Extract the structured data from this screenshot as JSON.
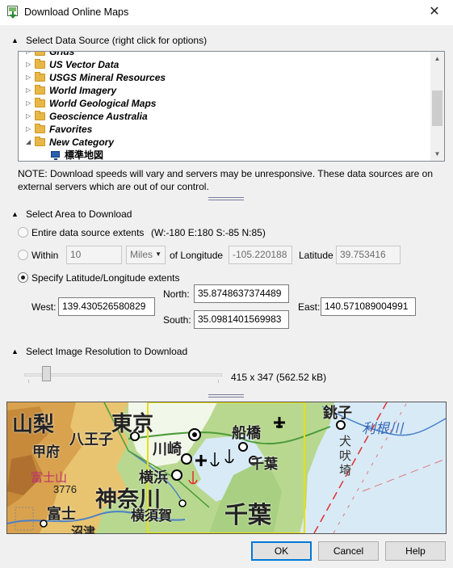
{
  "window": {
    "title": "Download Online Maps",
    "close_glyph": "✕"
  },
  "data_source": {
    "header": "Select Data Source (right click for options)",
    "tree": [
      {
        "label": "Grids",
        "type": "folder",
        "expander": "▷"
      },
      {
        "label": "US Vector Data",
        "type": "folder",
        "expander": "▷"
      },
      {
        "label": "USGS Mineral Resources",
        "type": "folder",
        "expander": "▷"
      },
      {
        "label": "World Imagery",
        "type": "folder",
        "expander": "▷"
      },
      {
        "label": "World Geological Maps",
        "type": "folder",
        "expander": "▷"
      },
      {
        "label": "Geoscience Australia",
        "type": "folder",
        "expander": "▷"
      },
      {
        "label": "Favorites",
        "type": "folder",
        "expander": "▷"
      },
      {
        "label": "New Category",
        "type": "folder",
        "expander": "◢"
      },
      {
        "label": "標準地図",
        "type": "map"
      }
    ],
    "note": "NOTE: Download speeds will vary and servers may be unresponsive.  These data sources are on external servers which are out of our control."
  },
  "area": {
    "header": "Select Area to Download",
    "entire": {
      "label": "Entire data source extents",
      "extents": "(W:-180 E:180 S:-85 N:85)"
    },
    "within": {
      "label": "Within",
      "distance": "10",
      "unit": "Miles",
      "of_longitude_label": "of Longitude",
      "longitude": "-105.220188",
      "latitude_label": "Latitude",
      "latitude": "39.753416"
    },
    "specify": {
      "label": "Specify Latitude/Longitude extents"
    },
    "extents": {
      "north_label": "North:",
      "north": "35.8748637374489",
      "west_label": "West:",
      "west": "139.430526580829",
      "east_label": "East:",
      "east": "140.571089004991",
      "south_label": "South:",
      "south": "35.0981401569983"
    },
    "selected": "specify"
  },
  "resolution": {
    "header": "Select Image Resolution to Download",
    "size_text": "415 x 347  (562.52 kB)",
    "slider_value": 0.11
  },
  "map_preview": {
    "labels": {
      "yamanashi": "山梨",
      "hachioji": "八王子",
      "tokyo": "東京",
      "kawasaki": "川崎",
      "funabashi": "船橋",
      "choshi": "銚子",
      "tonegawa": "利根川",
      "kofu": "甲府",
      "chiba_city": "千葉",
      "inubosaki": "犬吠埼",
      "fujisan": "富士山",
      "fuji_elevation": "3776",
      "yokohama": "横浜",
      "kanagawa": "神奈川",
      "fuji": "富士",
      "yokosuka": "横須賀",
      "chiba_pref": "千葉",
      "numazu": "沼津"
    },
    "colors": {
      "sea": "#d8eaf6",
      "lowland": "#b8d890",
      "hills": "#e8c470",
      "mountains": "#c68a3a",
      "urban": "#ffffff",
      "selection": "#e8e010"
    }
  },
  "buttons": {
    "ok": "OK",
    "cancel": "Cancel",
    "help": "Help"
  }
}
